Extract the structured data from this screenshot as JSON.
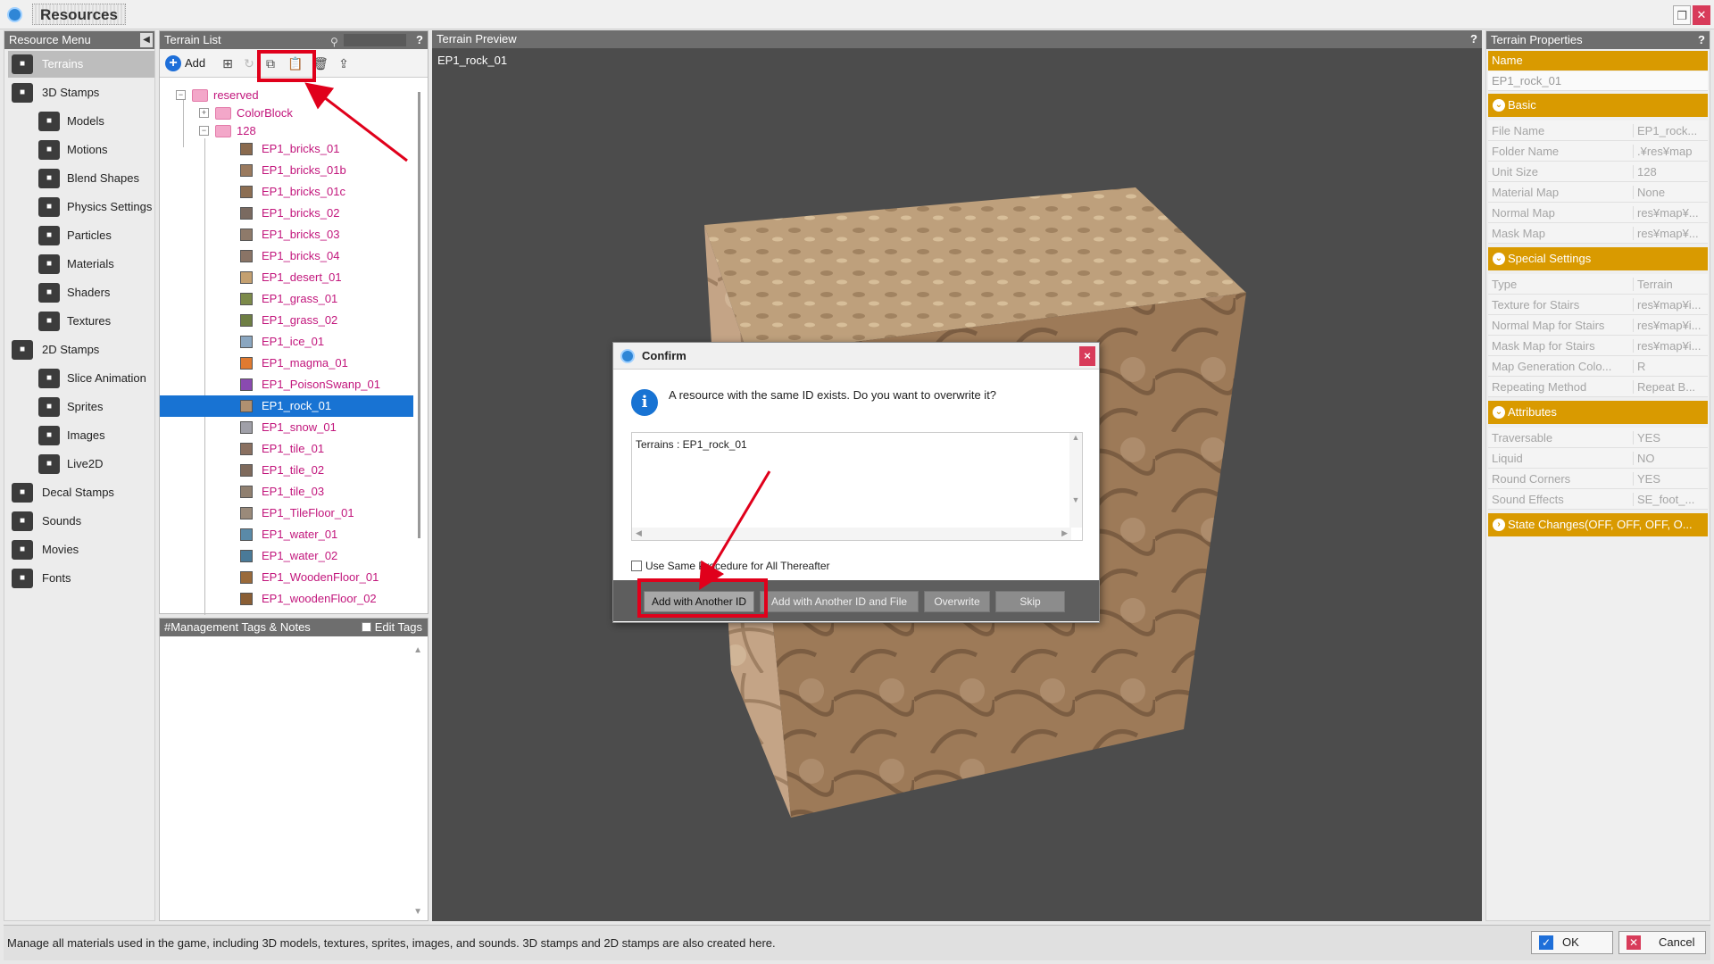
{
  "app": {
    "title": "Resources"
  },
  "resource_menu": {
    "header": "Resource Menu",
    "items": [
      {
        "label": "Terrains",
        "icon": "terrain-icon",
        "level": "top",
        "selected": true
      },
      {
        "label": "3D Stamps",
        "icon": "3d-icon",
        "level": "top"
      },
      {
        "label": "Models",
        "icon": "model-icon",
        "level": "sub"
      },
      {
        "label": "Motions",
        "icon": "motion-icon",
        "level": "sub"
      },
      {
        "label": "Blend Shapes",
        "icon": "blend-shape-icon",
        "level": "sub"
      },
      {
        "label": "Physics Settings",
        "icon": "physics-icon",
        "level": "sub"
      },
      {
        "label": "Particles",
        "icon": "particle-icon",
        "level": "sub"
      },
      {
        "label": "Materials",
        "icon": "material-icon",
        "level": "sub"
      },
      {
        "label": "Shaders",
        "icon": "shader-icon",
        "level": "sub"
      },
      {
        "label": "Textures",
        "icon": "texture-icon",
        "level": "sub"
      },
      {
        "label": "2D Stamps",
        "icon": "2d-icon",
        "level": "top"
      },
      {
        "label": "Slice Animation",
        "icon": "slice-animation-icon",
        "level": "sub"
      },
      {
        "label": "Sprites",
        "icon": "sprite-icon",
        "level": "sub"
      },
      {
        "label": "Images",
        "icon": "image-icon",
        "level": "sub"
      },
      {
        "label": "Live2D",
        "icon": "live2d-icon",
        "level": "sub"
      },
      {
        "label": "Decal Stamps",
        "icon": "decal-icon",
        "level": "top"
      },
      {
        "label": "Sounds",
        "icon": "sound-icon",
        "level": "top"
      },
      {
        "label": "Movies",
        "icon": "movie-icon",
        "level": "top"
      },
      {
        "label": "Fonts",
        "icon": "font-icon",
        "level": "top"
      }
    ]
  },
  "terrain_list": {
    "header": "Terrain List",
    "help": "?",
    "add_label": "Add",
    "tree": {
      "root": "reserved",
      "folder1": "ColorBlock",
      "folder2": "128",
      "items": [
        {
          "label": "EP1_bricks_01",
          "color": "#8a6a4e"
        },
        {
          "label": "EP1_bricks_01b",
          "color": "#9a7a5e"
        },
        {
          "label": "EP1_bricks_01c",
          "color": "#8c6e52"
        },
        {
          "label": "EP1_bricks_02",
          "color": "#7a6a60"
        },
        {
          "label": "EP1_bricks_03",
          "color": "#8e7a6a"
        },
        {
          "label": "EP1_bricks_04",
          "color": "#8a7466"
        },
        {
          "label": "EP1_desert_01",
          "color": "#c4a070"
        },
        {
          "label": "EP1_grass_01",
          "color": "#7c8a4a"
        },
        {
          "label": "EP1_grass_02",
          "color": "#6e7e44"
        },
        {
          "label": "EP1_ice_01",
          "color": "#8aa6c0"
        },
        {
          "label": "EP1_magma_01",
          "color": "#e07a30"
        },
        {
          "label": "EP1_PoisonSwanp_01",
          "color": "#8a4ab0"
        },
        {
          "label": "EP1_rock_01",
          "color": "#b09070",
          "selected": true
        },
        {
          "label": "EP1_snow_01",
          "color": "#a0a0a8"
        },
        {
          "label": "EP1_tile_01",
          "color": "#8a7060"
        },
        {
          "label": "EP1_tile_02",
          "color": "#7e6a5c"
        },
        {
          "label": "EP1_tile_03",
          "color": "#908070"
        },
        {
          "label": "EP1_TileFloor_01",
          "color": "#9a8a7a"
        },
        {
          "label": "EP1_water_01",
          "color": "#5a8aa8"
        },
        {
          "label": "EP1_water_02",
          "color": "#4a7a98"
        },
        {
          "label": "EP1_WoodenFloor_01",
          "color": "#9a6a3a"
        },
        {
          "label": "EP1_woodenFloor_02",
          "color": "#8a5e34"
        }
      ]
    }
  },
  "tags_panel": {
    "header": "#Management Tags & Notes",
    "edit_tags": "Edit Tags"
  },
  "preview": {
    "header": "Terrain Preview",
    "help": "?",
    "label": "EP1_rock_01"
  },
  "properties": {
    "header": "Terrain Properties",
    "help": "?",
    "name_header": "Name",
    "name_value": "EP1_rock_01",
    "basic": {
      "title": "Basic",
      "rows": [
        {
          "k": "File Name",
          "v": "EP1_rock..."
        },
        {
          "k": "Folder Name",
          "v": ".¥res¥map"
        },
        {
          "k": "Unit Size",
          "v": "128"
        },
        {
          "k": "Material Map",
          "v": "None"
        },
        {
          "k": "Normal Map",
          "v": "res¥map¥..."
        },
        {
          "k": "Mask Map",
          "v": "res¥map¥..."
        }
      ]
    },
    "special": {
      "title": "Special Settings",
      "rows": [
        {
          "k": "Type",
          "v": "Terrain"
        },
        {
          "k": "Texture for Stairs",
          "v": "res¥map¥i..."
        },
        {
          "k": "Normal Map for Stairs",
          "v": "res¥map¥i..."
        },
        {
          "k": "Mask Map for Stairs",
          "v": "res¥map¥i..."
        },
        {
          "k": "Map Generation Colo...",
          "v": "R"
        },
        {
          "k": "Repeating Method",
          "v": "Repeat B..."
        }
      ]
    },
    "attributes": {
      "title": "Attributes",
      "rows": [
        {
          "k": "Traversable",
          "v": "YES"
        },
        {
          "k": "Liquid",
          "v": "NO"
        },
        {
          "k": "Round Corners",
          "v": "YES"
        },
        {
          "k": "Sound Effects",
          "v": "SE_foot_..."
        }
      ]
    },
    "state_changes": "State Changes(OFF, OFF, OFF, O..."
  },
  "dialog": {
    "title": "Confirm",
    "close": "×",
    "message": "A resource with the same ID exists. Do you want to overwrite it?",
    "list_item": "Terrains : EP1_rock_01",
    "checkbox_label": "Use Same Procedure for All Thereafter",
    "buttons": {
      "add_another_id": "Add with Another ID",
      "add_another_id_file": "Add with Another ID and File",
      "overwrite": "Overwrite",
      "skip": "Skip"
    }
  },
  "status": {
    "text": "Manage all materials used in the game, including 3D models, textures, sprites, images, and sounds. 3D stamps and 2D stamps are also created here.",
    "ok": "OK",
    "cancel": "Cancel"
  },
  "colors": {
    "accent": "#d99a00",
    "selection": "#1873d3",
    "annotation": "#e0001b",
    "tree_text": "#c2167c"
  }
}
